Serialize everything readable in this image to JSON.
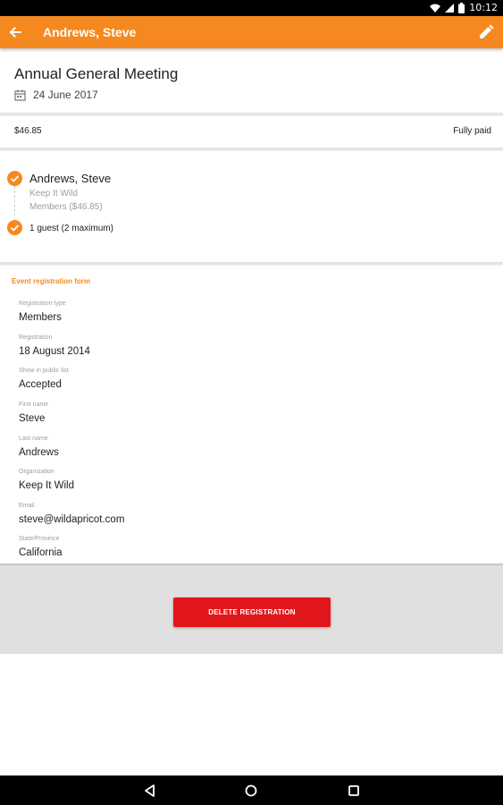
{
  "status_bar": {
    "time": "10:12",
    "icons": [
      "wifi-icon",
      "signal-icon",
      "battery-icon"
    ]
  },
  "app_bar": {
    "title": "Andrews, Steve",
    "back_icon": "arrow-left-icon",
    "edit_icon": "pencil-icon"
  },
  "event": {
    "title": "Annual General Meeting",
    "date": "24 June 2017",
    "date_icon": "calendar-icon"
  },
  "payment": {
    "amount": "$46.85",
    "status": "Fully paid"
  },
  "registrant": {
    "name": "Andrews, Steve",
    "organization": "Keep It Wild",
    "level": "Members ($46.85)",
    "guests": "1 guest (2 maximum)"
  },
  "form": {
    "title": "Event registration form",
    "fields": [
      {
        "label": "Registration type",
        "value": "Members"
      },
      {
        "label": "Registration",
        "value": "18 August 2014"
      },
      {
        "label": "Show in public list",
        "value": "Accepted"
      },
      {
        "label": "First name",
        "value": "Steve"
      },
      {
        "label": "Last name",
        "value": "Andrews"
      },
      {
        "label": "Organization",
        "value": "Keep It Wild"
      },
      {
        "label": "Email",
        "value": "steve@wildapricot.com"
      },
      {
        "label": "State/Province",
        "value": "California"
      }
    ]
  },
  "actions": {
    "delete_label": "DELETE REGISTRATION"
  },
  "colors": {
    "accent": "#f5891f",
    "danger": "#e2171b",
    "muted": "#9e9e9e"
  }
}
